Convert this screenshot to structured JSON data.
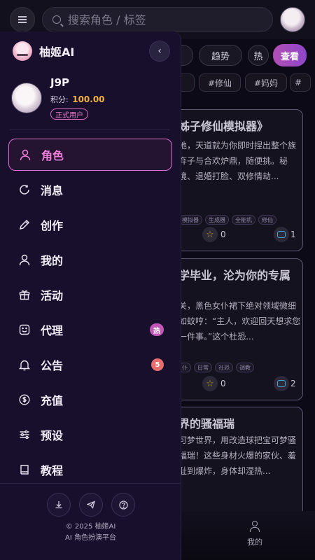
{
  "header": {
    "search_placeholder": "搜索角色 / 标签",
    "menu_icon": "hamburger-icon",
    "avatar_icon": "avatar"
  },
  "filters": {
    "chips": [
      "趋势",
      "热"
    ],
    "view_label": "查看",
    "tags": [
      "#修仙",
      "#妈妈",
      "#"
    ]
  },
  "cards": [
    {
      "title": "姊子修仙模拟器》",
      "desc": "地，天道就为你即时捏出整个族弃子与合欢炉鼎，随便挑。秘境、退婚打脸、双修情劫...",
      "tags": [
        "模拟器",
        "生成器",
        "全能机",
        "修仙"
      ],
      "stars": "0",
      "comments": "1"
    },
    {
      "title": "学毕业，沦为你的专属",
      "desc": "关，黑色女仆裙下绝对领域微细如蚊哼：“主人，欢迎回天想求您一件事。”这个杜恐...",
      "tags": [
        "仆",
        "日常",
        "社恐",
        "调教"
      ],
      "stars": "0",
      "comments": "2"
    },
    {
      "title": "界的骚福瑞",
      "desc": "可梦世界，用改造球把宝可梦骚福瑞！这些身材火爆的家伙、羞耻到爆炸，身体却湿热...",
      "tags": [],
      "stars": "",
      "comments": ""
    }
  ],
  "bottom_nav": {
    "me_label": "我的"
  },
  "drawer": {
    "brand_name": "柚姬AI",
    "user": {
      "name": "J9P",
      "points_label": "积分:",
      "points_value": "100.00",
      "badge": "正式用户"
    },
    "menu": [
      {
        "label": "角色",
        "icon": "person-icon",
        "active": true,
        "badge": ""
      },
      {
        "label": "消息",
        "icon": "message-icon",
        "active": false,
        "badge": ""
      },
      {
        "label": "创作",
        "icon": "pencil-icon",
        "active": false,
        "badge": ""
      },
      {
        "label": "我的",
        "icon": "user-icon",
        "active": false,
        "badge": ""
      },
      {
        "label": "活动",
        "icon": "gift-icon",
        "active": false,
        "badge": ""
      },
      {
        "label": "代理",
        "icon": "smile-icon",
        "active": false,
        "badge": "热"
      },
      {
        "label": "公告",
        "icon": "bell-icon",
        "active": false,
        "badge": "5"
      },
      {
        "label": "充值",
        "icon": "dollar-icon",
        "active": false,
        "badge": ""
      },
      {
        "label": "预设",
        "icon": "sliders-icon",
        "active": false,
        "badge": ""
      },
      {
        "label": "教程",
        "icon": "book-icon",
        "active": false,
        "badge": ""
      }
    ],
    "footer": {
      "copyright": "© 2025 柚姬AI",
      "subtitle": "AI 角色扮演平台"
    }
  },
  "colors": {
    "accent": "#f07fd8",
    "points": "#f2b13c",
    "hot_badge": "#c257b8",
    "count_badge": "#e56d6d"
  }
}
